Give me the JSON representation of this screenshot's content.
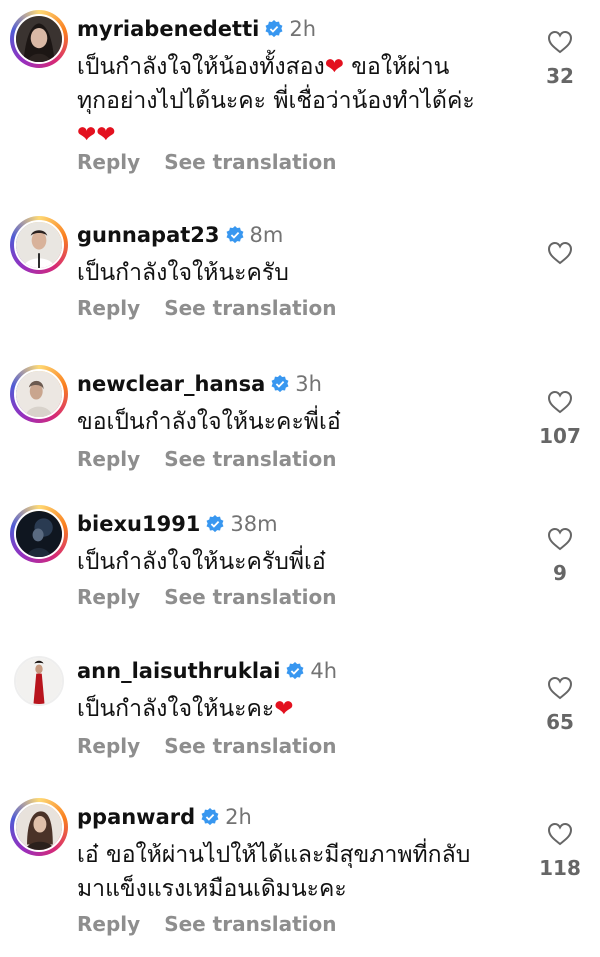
{
  "comments": [
    {
      "username": "myriabenedetti",
      "time": "2h",
      "lines": [
        "เป็นกำลังใจให้น้องทั้งสอง",
        "ขอให้ผ่าน",
        "ทุกอย่างไปได้นะคะ พี่เชื่อว่าน้องทำได้ค่ะ"
      ],
      "likes": "32",
      "reply": "Reply",
      "translation": "See translation"
    },
    {
      "username": "gunnapat23",
      "time": "8m",
      "lines": [
        "เป็นกำลังใจให้นะครับ"
      ],
      "likes": "",
      "reply": "Reply",
      "translation": "See translation"
    },
    {
      "username": "newclear_hansa",
      "time": "3h",
      "lines": [
        "ขอเป็นกำลังใจให้นะคะพี่เอ๋"
      ],
      "likes": "107",
      "reply": "Reply",
      "translation": "See translation"
    },
    {
      "username": "biexu1991",
      "time": "38m",
      "lines": [
        "เป็นกำลังใจให้นะครับพี่เอ๋"
      ],
      "likes": "9",
      "reply": "Reply",
      "translation": "See translation"
    },
    {
      "username": "ann_laisuthruklai",
      "time": "4h",
      "lines": [
        "เป็นกำลังใจให้นะคะ"
      ],
      "likes": "65",
      "reply": "Reply",
      "translation": "See translation"
    },
    {
      "username": "ppanward",
      "time": "2h",
      "lines": [
        "เอ๋ ขอให้ผ่านไปให้ได้และมีสุขภาพที่กลับ",
        "มาแข็งแรงเหมือนเดิมนะคะ"
      ],
      "likes": "118",
      "reply": "Reply",
      "translation": "See translation"
    }
  ],
  "colors": {
    "verified": "#3897f0",
    "heart": "#e3111f",
    "secondary_text": "#8e8e8e"
  },
  "icons": {
    "like": "heart-outline-icon",
    "verified": "verified-badge-icon",
    "emoji": "red-heart-emoji"
  }
}
